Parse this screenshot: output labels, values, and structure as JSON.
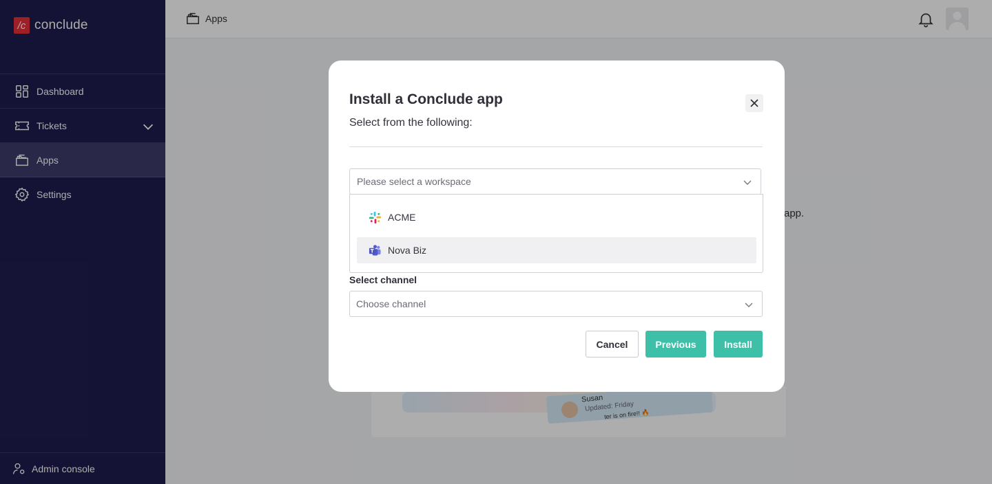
{
  "sidebar": {
    "brand": {
      "mark": "/c",
      "name": "conclude",
      "color": "#e8303a"
    },
    "items": [
      {
        "label": "Dashboard",
        "icon": "dashboard-grid-icon"
      },
      {
        "label": "Tickets",
        "icon": "ticket-icon",
        "has_chevron": true
      },
      {
        "label": "Apps",
        "icon": "apps-folder-icon",
        "active": true
      },
      {
        "label": "Settings",
        "icon": "gear-icon"
      }
    ],
    "admin_label": "Admin console",
    "bg_color": "#1f1d4f"
  },
  "topbar": {
    "breadcrumb": "Apps",
    "icons": [
      "bell-icon",
      "avatar"
    ]
  },
  "background": {
    "partial_text": "app.",
    "card": {
      "name": "Susan",
      "updated": "Updated: Friday",
      "note": "ter is on fire!! 🔥"
    }
  },
  "modal": {
    "title": "Install a Conclude app",
    "subtitle": "Select from the following:",
    "workspace_select": {
      "placeholder": "Please select a workspace",
      "options": [
        {
          "label": "ACME",
          "icon": "slack-icon"
        },
        {
          "label": "Nova Biz",
          "icon": "teams-icon",
          "highlighted": true
        }
      ]
    },
    "channel": {
      "label": "Select channel",
      "placeholder": "Choose channel"
    },
    "buttons": {
      "cancel": "Cancel",
      "previous": "Previous",
      "install": "Install"
    },
    "accent_color": "#3ebfa8"
  }
}
